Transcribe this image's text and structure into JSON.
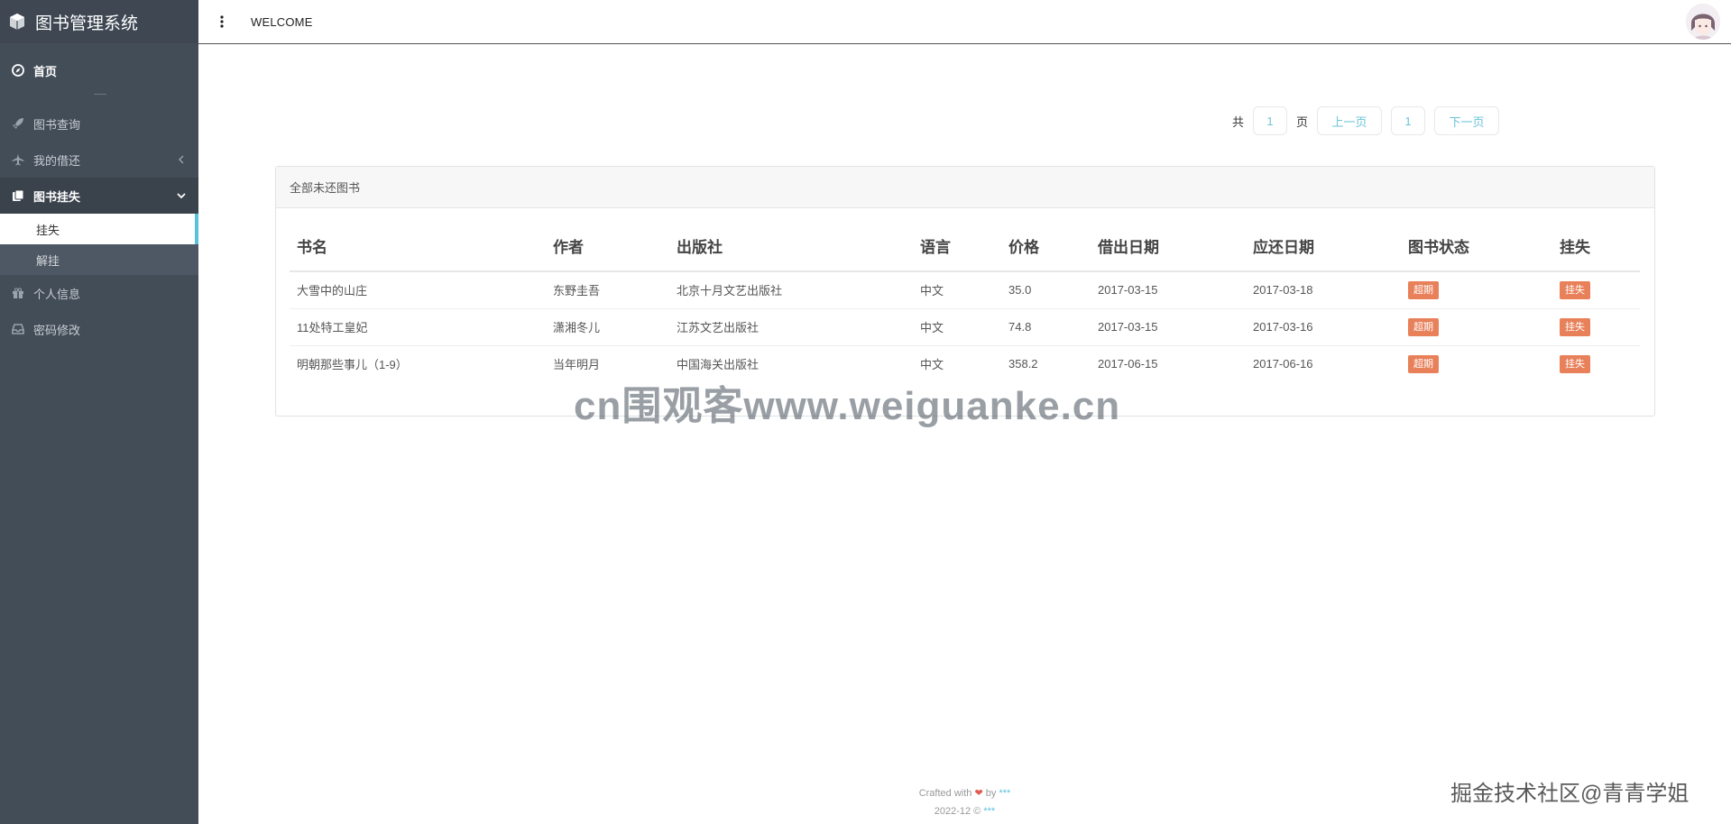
{
  "sidebar": {
    "brand": "图书管理系统",
    "home": "首页",
    "items": [
      {
        "label": "图书查询"
      },
      {
        "label": "我的借还"
      },
      {
        "label": "图书挂失"
      },
      {
        "label": "个人信息"
      },
      {
        "label": "密码修改"
      }
    ],
    "sub_items": [
      {
        "label": "挂失"
      },
      {
        "label": "解挂"
      }
    ]
  },
  "header": {
    "title": "WELCOME"
  },
  "pager": {
    "total_prefix": "共",
    "total_pages": "1",
    "total_suffix": "页",
    "prev_label": "上一页",
    "current": "1",
    "next_label": "下一页"
  },
  "panel": {
    "title": "全部未还图书",
    "columns": [
      "书名",
      "作者",
      "出版社",
      "语言",
      "价格",
      "借出日期",
      "应还日期",
      "图书状态",
      "挂失"
    ],
    "rows": [
      {
        "name": "大雪中的山庄",
        "author": "东野圭吾",
        "publisher": "北京十月文艺出版社",
        "lang": "中文",
        "price": "35.0",
        "out": "2017-03-15",
        "due": "2017-03-18",
        "status": "超期",
        "action": "挂失"
      },
      {
        "name": "11处特工皇妃",
        "author": "潇湘冬儿",
        "publisher": "江苏文艺出版社",
        "lang": "中文",
        "price": "74.8",
        "out": "2017-03-15",
        "due": "2017-03-16",
        "status": "超期",
        "action": "挂失"
      },
      {
        "name": "明朝那些事儿（1-9）",
        "author": "当年明月",
        "publisher": "中国海关出版社",
        "lang": "中文",
        "price": "358.2",
        "out": "2017-06-15",
        "due": "2017-06-16",
        "status": "超期",
        "action": "挂失"
      }
    ]
  },
  "watermark": "cn围观客www.weiguanke.cn",
  "watermark2": "掘金技术社区@青青学姐",
  "footer": {
    "crafted": "Crafted with",
    "by": "by",
    "author": "***",
    "date": "2022-12 ©",
    "owner": "***"
  },
  "colors": {
    "sidebar_bg": "#434d58",
    "accent": "#5bc0de",
    "badge": "#e8805a"
  }
}
